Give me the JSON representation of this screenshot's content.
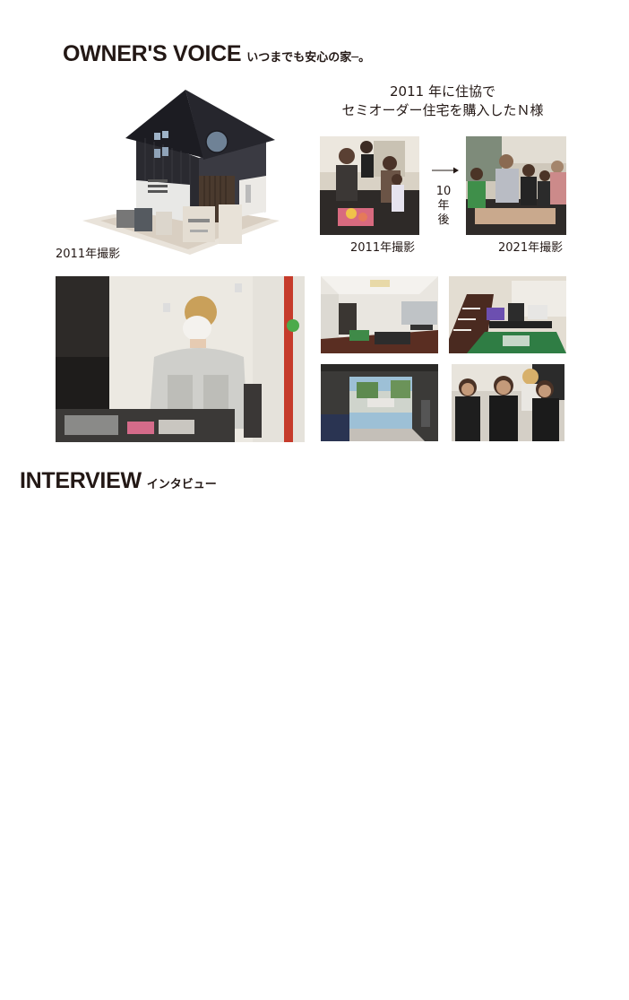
{
  "owners_voice": {
    "title": "OWNER'S VOICE",
    "subtitle": "いつまでも安心の家─。"
  },
  "intro": {
    "line1": "2011 年に住協で",
    "line2": "セミオーダー住宅を購入したＮ様"
  },
  "house_caption": "2011年撮影",
  "family_before_caption": "2011年撮影",
  "family_after_caption": "2021年撮影",
  "arrow_label": [
    "10",
    "年",
    "後"
  ],
  "interview": {
    "title": "INTERVIEW",
    "subtitle": "インタビュー"
  }
}
